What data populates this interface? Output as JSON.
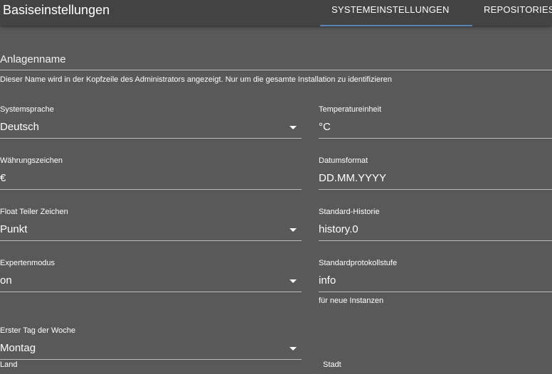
{
  "header": {
    "title": "Basiseinstellungen",
    "tabs": [
      {
        "label": "SYSTEMEINSTELLUNGEN",
        "active": true
      },
      {
        "label": "REPOSITORIES",
        "active": false
      }
    ]
  },
  "form": {
    "anlagenname": {
      "label": "Anlagenname",
      "value": "",
      "help": "Dieser Name wird in der Kopfzeile des Administrators angezeigt. Nur um die gesamte Installation zu identifizieren"
    },
    "systemsprache": {
      "label": "Systemsprache",
      "value": "Deutsch"
    },
    "temperatureinheit": {
      "label": "Temperatureinheit",
      "value": "°C"
    },
    "waehrungszeichen": {
      "label": "Währungszeichen",
      "value": "€"
    },
    "datumsformat": {
      "label": "Datumsformat",
      "value": "DD.MM.YYYY"
    },
    "float_teiler": {
      "label": "Float Teiler Zeichen",
      "value": "Punkt"
    },
    "standard_historie": {
      "label": "Standard-Historie",
      "value": "history.0"
    },
    "expertenmodus": {
      "label": "Expertenmodus",
      "value": "on"
    },
    "standardprotokollstufe": {
      "label": "Standardprotokollstufe",
      "value": "info",
      "help": "für neue Instanzen"
    },
    "erster_tag": {
      "label": "Erster Tag der Woche",
      "value": "Montag"
    },
    "land": {
      "label": "Land"
    },
    "stadt": {
      "label": "Stadt"
    }
  },
  "colors": {
    "background": "#595959",
    "topbar": "#434343",
    "tab_indicator": "#5b84b6",
    "underline": "#bdbdbd"
  }
}
